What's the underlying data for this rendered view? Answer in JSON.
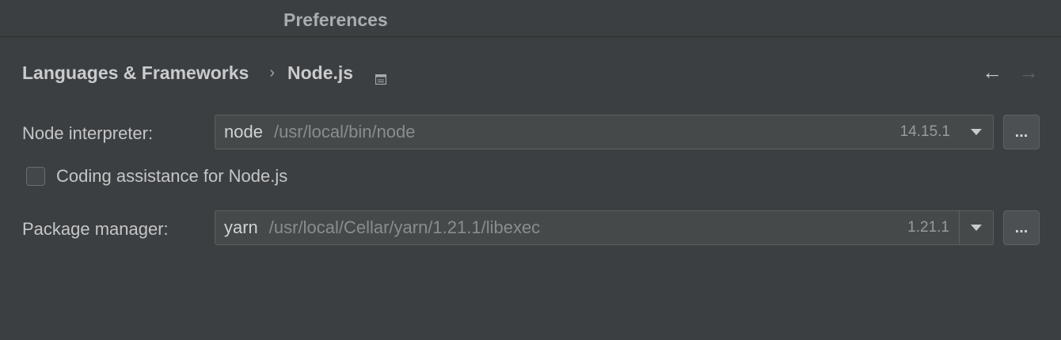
{
  "window": {
    "title": "Preferences"
  },
  "breadcrumb": {
    "parent": "Languages & Frameworks",
    "separator": "›",
    "current": "Node.js",
    "icon": "document-icon"
  },
  "nav": {
    "back_glyph": "←",
    "forward_glyph": "→"
  },
  "interpreter": {
    "label": "Node interpreter:",
    "name": "node",
    "path": "/usr/local/bin/node",
    "version": "14.15.1",
    "browse_label": "..."
  },
  "coding_assistance": {
    "label": "Coding assistance for Node.js",
    "checked": false
  },
  "package_manager": {
    "label": "Package manager:",
    "name": "yarn",
    "path": "/usr/local/Cellar/yarn/1.21.1/libexec",
    "version": "1.21.1",
    "browse_label": "..."
  },
  "colors": {
    "background": "#3c3f41",
    "field_background": "#45494a",
    "border": "#5e6060"
  }
}
